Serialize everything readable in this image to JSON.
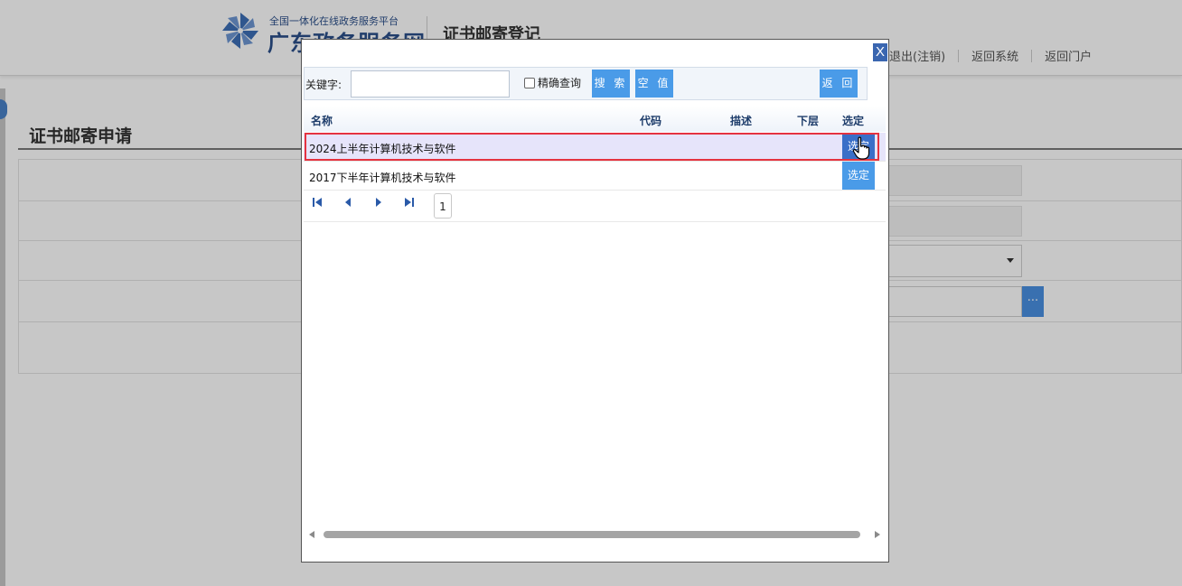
{
  "header": {
    "logo_subtitle": "全国一体化在线政务服务平台",
    "logo_title": "广东政务服务网",
    "page_title": "证书邮寄登记",
    "links": [
      {
        "label": "退出(注销)"
      },
      {
        "label": "返回系统"
      },
      {
        "label": "返回门户"
      }
    ]
  },
  "section": {
    "title": "证书邮寄申请"
  },
  "dialog": {
    "close_label": "X",
    "toolbar": {
      "keyword_label": "关键字:",
      "keyword_value": "",
      "exact_label": "精确查询",
      "exact_checked": false,
      "search_label": "搜 索",
      "clear_label": "空 值",
      "back_label": "返 回"
    },
    "columns": {
      "name": "名称",
      "code": "代码",
      "desc": "描述",
      "lower": "下层",
      "select": "选定"
    },
    "rows": [
      {
        "name": "2024上半年计算机技术与软件",
        "select_label": "选定",
        "highlighted": true
      },
      {
        "name": "2017下半年计算机技术与软件",
        "select_label": "选定",
        "highlighted": false
      }
    ],
    "pager": {
      "current_page": "1"
    }
  },
  "form": {
    "lookup_button": "···"
  },
  "colors": {
    "accent_button": "#4a9be8",
    "close_button": "#3a66b0",
    "highlight_frame": "#e53340",
    "highlight_row": "#e6e4fa",
    "header_text": "#1e3d6b"
  },
  "icons": [
    "pinwheel-logo-icon",
    "first-page-icon",
    "prev-page-icon",
    "next-page-icon",
    "last-page-icon",
    "hand-cursor-icon",
    "dropdown-caret-icon"
  ]
}
